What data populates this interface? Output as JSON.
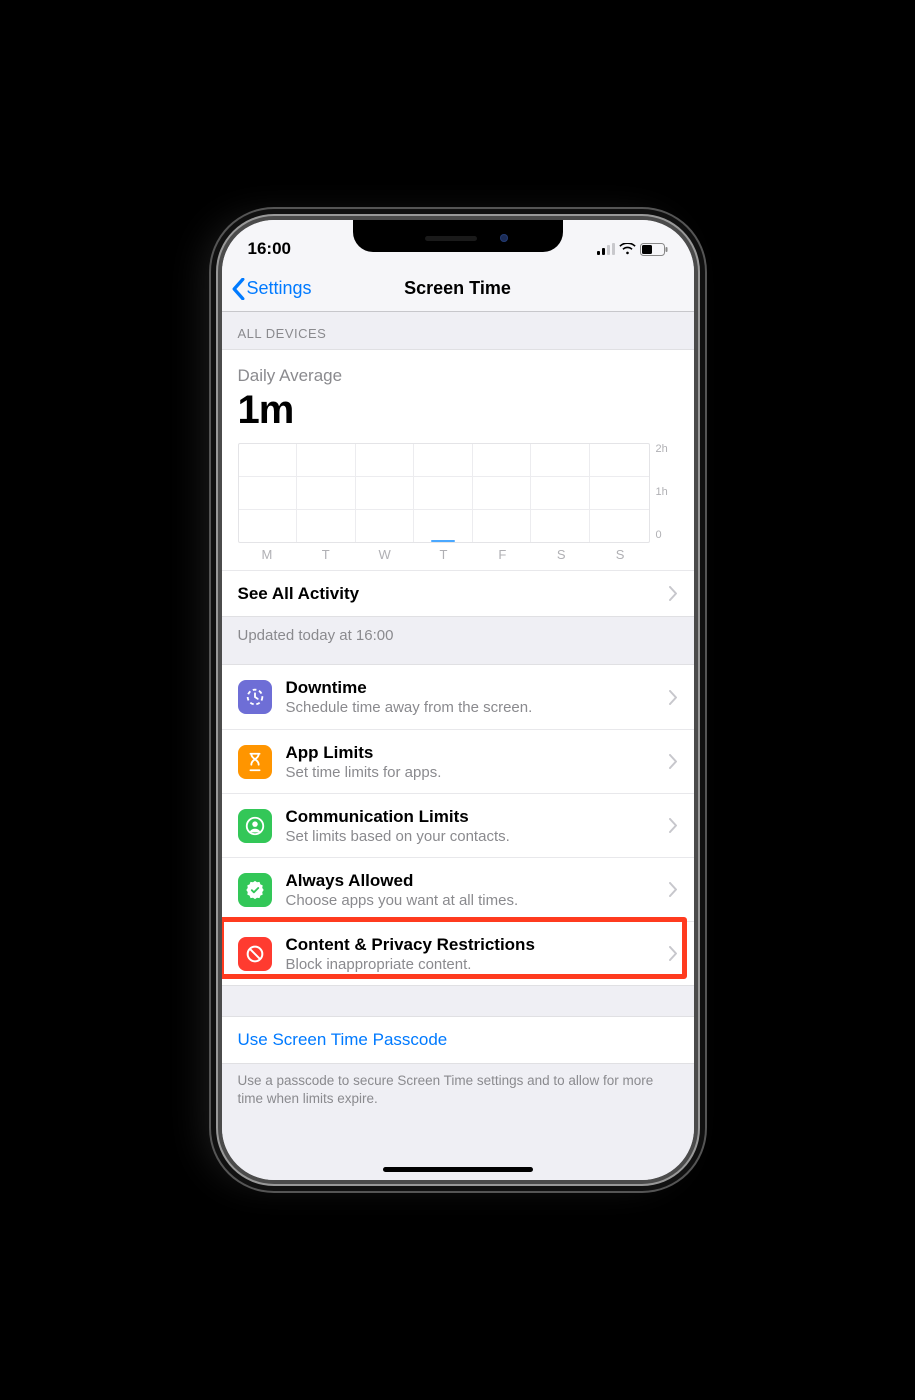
{
  "status": {
    "time": "16:00"
  },
  "nav": {
    "back": "Settings",
    "title": "Screen Time"
  },
  "section_all_devices": "ALL DEVICES",
  "daily": {
    "label": "Daily Average",
    "value": "1m"
  },
  "chart_data": {
    "type": "bar",
    "categories": [
      "M",
      "T",
      "W",
      "T",
      "F",
      "S",
      "S"
    ],
    "values": [
      0,
      0,
      0,
      0.05,
      0,
      0,
      0
    ],
    "ylim": [
      0,
      2
    ],
    "yticks": [
      "2h",
      "1h",
      "0"
    ],
    "xlabel": "",
    "ylabel": "",
    "title": ""
  },
  "see_all": "See All Activity",
  "updated": "Updated today at 16:00",
  "rows": [
    {
      "title": "Downtime",
      "sub": "Schedule time away from the screen.",
      "color": "#6e6ed6",
      "icon": "clock-wait"
    },
    {
      "title": "App Limits",
      "sub": "Set time limits for apps.",
      "color": "#ff9500",
      "icon": "hourglass"
    },
    {
      "title": "Communication Limits",
      "sub": "Set limits based on your contacts.",
      "color": "#33c758",
      "icon": "person-circle"
    },
    {
      "title": "Always Allowed",
      "sub": "Choose apps you want at all times.",
      "color": "#33c758",
      "icon": "badge-check"
    },
    {
      "title": "Content & Privacy Restrictions",
      "sub": "Block inappropriate content.",
      "color": "#ff3b30",
      "icon": "ban"
    }
  ],
  "passcode": {
    "label": "Use Screen Time Passcode"
  },
  "passcode_note": "Use a passcode to secure Screen Time settings and to allow for more time when limits expire."
}
